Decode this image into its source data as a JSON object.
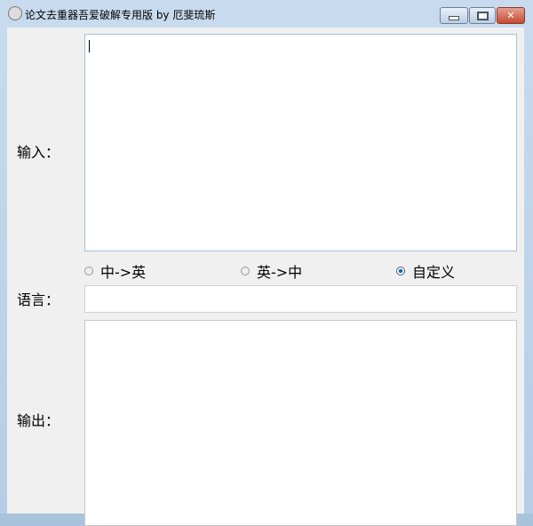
{
  "window": {
    "title": "论文去重器吾爱破解专用版 by 厄斐琉斯",
    "minimize": "—",
    "maximize": "□",
    "close": "✕"
  },
  "labels": {
    "input": "输入：",
    "language": "语言：",
    "output": "输出："
  },
  "radios": [
    {
      "label": "中->英",
      "checked": false
    },
    {
      "label": "英->中",
      "checked": false
    },
    {
      "label": "自定义",
      "checked": true
    }
  ],
  "fields": {
    "input_value": "",
    "language_value": "",
    "output_value": ""
  }
}
